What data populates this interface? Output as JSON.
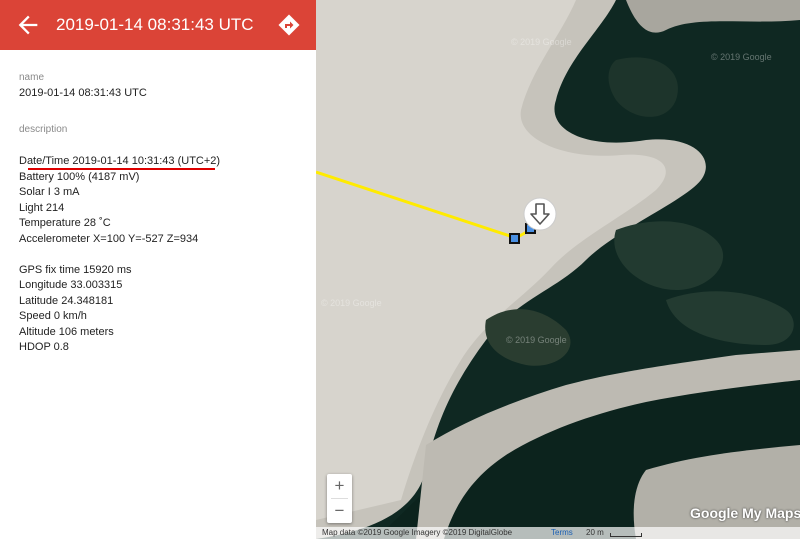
{
  "header": {
    "title": "2019-01-14 08:31:43 UTC",
    "back_icon": "arrow-left-icon",
    "directions_icon": "directions-icon",
    "color": "#db4437"
  },
  "details": {
    "name_label": "name",
    "name_value": "2019-01-14 08:31:43 UTC",
    "description_label": "description",
    "description_lines": [
      "Date/Time 2019-01-14 10:31:43 (UTC+2)",
      "Battery 100% (4187 mV)",
      "Solar I 3 mA",
      "Light 214",
      "Temperature 28 ˚C",
      "Accelerometer X=100 Y=-527 Z=934",
      "",
      "GPS fix time 15920 ms",
      "Longitude 33.003315",
      "Latitude 24.348181",
      "Speed 0 km/h",
      "Altitude 106 meters",
      "HDOP 0.8"
    ]
  },
  "map": {
    "zoom_in": "+",
    "zoom_out": "−",
    "attribution": "Map data ©2019 Google Imagery ©2019 DigitalGlobe",
    "terms": "Terms",
    "scale": "20 m",
    "logo": "Google My Maps",
    "track_color": "#ffeb00",
    "marker_icon": "download-arrow-icon",
    "watermark": "© 2019 Google"
  }
}
